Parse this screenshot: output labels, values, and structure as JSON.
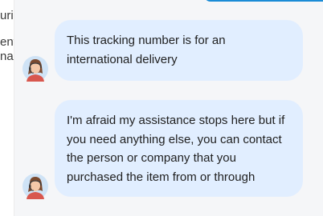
{
  "sidebar": {
    "fragments": [
      "uri",
      "ent",
      "na"
    ]
  },
  "messages": [
    {
      "sender": "agent",
      "avatar_icon": "agent-avatar-icon",
      "text": "This tracking number is for an international delivery"
    },
    {
      "sender": "agent",
      "avatar_icon": "agent-avatar-icon",
      "text": "I'm afraid my assistance stops here but if you need anything else, you can contact the person or company that you purchased the item from or through"
    }
  ],
  "colors": {
    "bubble": "#e1eeff",
    "accent": "#1a8bd6",
    "background": "#f5f6f8"
  }
}
